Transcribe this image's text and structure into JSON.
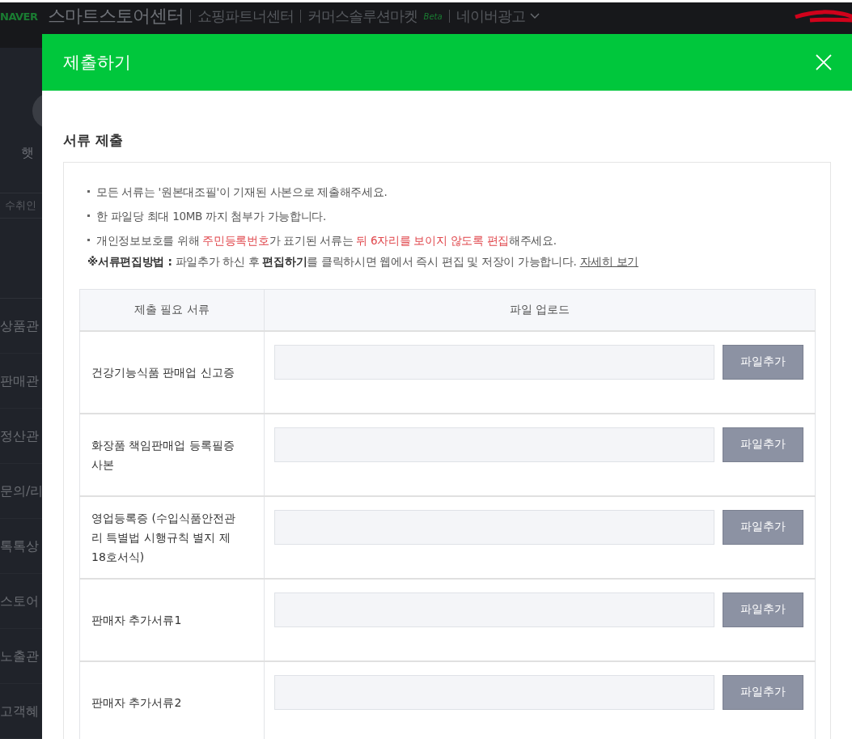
{
  "topbar": {
    "logo": "NAVER",
    "title": "스마트스토어센터",
    "links": [
      {
        "label": "쇼핑파트너센터"
      },
      {
        "label": "커머스솔루션마켓",
        "badge": "Beta"
      },
      {
        "label": "네이버광고",
        "dropdown": true
      }
    ]
  },
  "sidebar": {
    "profile_name": "햇",
    "search_tab": "수취인",
    "items": [
      {
        "label": "상품관"
      },
      {
        "label": "판매관"
      },
      {
        "label": "정산관"
      },
      {
        "label": "문의/리"
      },
      {
        "label": "톡톡상"
      },
      {
        "label": "스토어"
      },
      {
        "label": "노출관"
      },
      {
        "label": "고객혜"
      }
    ]
  },
  "modal": {
    "title": "제출하기",
    "section_title": "서류 제출",
    "notices": [
      {
        "segments": [
          {
            "kind": "plain",
            "text": "모든 서류는 '원본대조필'이 기재된 사본으로 제출해주세요."
          }
        ]
      },
      {
        "segments": [
          {
            "kind": "plain",
            "text": "한 파일당 최대 10MB 까지 첨부가 가능합니다."
          }
        ]
      },
      {
        "segments": [
          {
            "kind": "plain",
            "text": "개인정보보호를 위해 "
          },
          {
            "kind": "red",
            "text": "주민등록번호"
          },
          {
            "kind": "plain",
            "text": "가 표기된 서류는 "
          },
          {
            "kind": "red",
            "text": "뒤 6자리를 보이지 않도록 편집"
          },
          {
            "kind": "plain",
            "text": "해주세요."
          }
        ],
        "sub": [
          {
            "kind": "bold",
            "text": "※서류편집방법 :"
          },
          {
            "kind": "plain",
            "text": " 파일추가 하신 후 "
          },
          {
            "kind": "bold",
            "text": "편집하기"
          },
          {
            "kind": "plain",
            "text": "를 클릭하시면 웹에서 즉시 편집 및 저장이 가능합니다. "
          },
          {
            "kind": "link",
            "text": "자세히 보기"
          }
        ]
      }
    ],
    "table": {
      "columns": [
        "제출 필요 서류",
        "파일 업로드"
      ],
      "rows": [
        {
          "document": "건강기능식품 판매업 신고증",
          "button": "파일추가"
        },
        {
          "document": "화장품 책임판매업 등록필증 사본",
          "button": "파일추가"
        },
        {
          "document": "영업등록증 (수입식품안전관리 특별법 시행규칙 별지 제18호서식)",
          "button": "파일추가"
        },
        {
          "document": "판매자 추가서류1",
          "button": "파일추가"
        },
        {
          "document": "판매자 추가서류2",
          "button": "파일추가"
        }
      ]
    }
  }
}
